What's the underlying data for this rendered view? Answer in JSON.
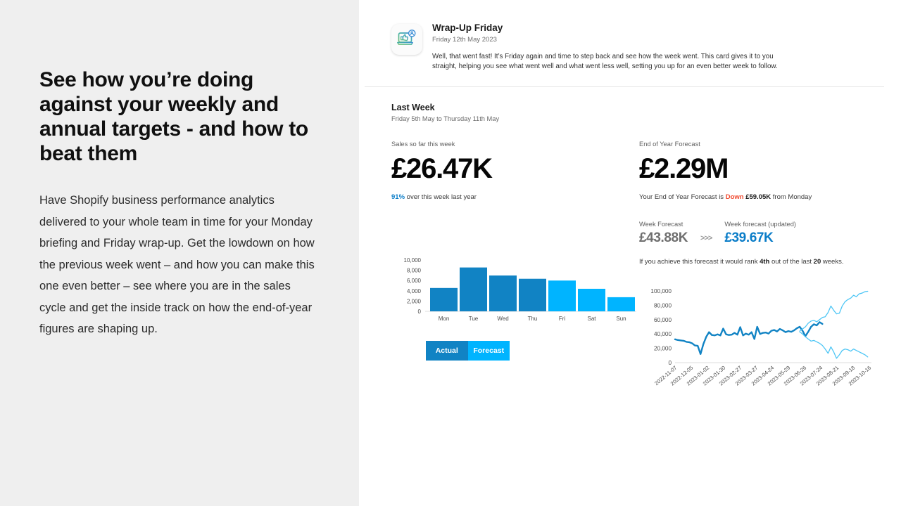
{
  "left": {
    "headline": "See how you’re doing against your weekly and annual targets - and how to beat them",
    "body": "Have Shopify business performance analytics delivered to your whole team in time for your Monday briefing and Friday wrap-up.  Get the lowdown on how the previous week went – and how you can make this one even better – see where you are in the sales cycle and get the inside track on how the end-of-year figures are shaping up."
  },
  "card": {
    "icon_name": "laptop-thumbs-up-icon",
    "title": "Wrap-Up Friday",
    "date": "Friday 12th May 2023",
    "body": "Well, that went fast! It’s Friday again and time to step back and see how the week went. This card gives it to you straight, helping you see what went well and what went less well, setting you up for an even better week to follow."
  },
  "section": {
    "title": "Last Week",
    "subtitle": "Friday 5th May to Thursday 11th May"
  },
  "sales": {
    "label": "Sales so far this week",
    "value": "£26.47K",
    "note_pct": "91%",
    "note_rest": " over this week last year"
  },
  "forecast": {
    "label": "End of Year Forecast",
    "value": "£2.29M",
    "note_prefix": "Your End of Year Forecast is ",
    "note_direction": "Down",
    "note_amount": " £59.05K",
    "note_suffix": " from Monday",
    "week_label_old": "Week Forecast",
    "week_value_old": "£43.88K",
    "arrow": ">>>",
    "week_label_new": "Week forecast (updated)",
    "week_value_new": "£39.67K",
    "rank_prefix": "If you achieve this forecast it would rank ",
    "rank_value": "4th",
    "rank_middle": " out of the last ",
    "rank_total": "20",
    "rank_suffix": " weeks."
  },
  "legend": {
    "actual": "Actual",
    "forecast": "Forecast"
  },
  "colors": {
    "actual_blue": "#1183c4",
    "forecast_blue": "#00b4ff",
    "accent_link": "#0b7dc8",
    "down_red": "#f0492f",
    "panel_gray": "#efefef"
  },
  "chart_data": [
    {
      "type": "bar",
      "title": "",
      "xlabel": "",
      "ylabel": "",
      "ylim": [
        0,
        10000
      ],
      "yticks": [
        "0",
        "2,000",
        "4,000",
        "6,000",
        "8,000",
        "10,000"
      ],
      "ytick_values": [
        0,
        2000,
        4000,
        6000,
        8000,
        10000
      ],
      "grid": false,
      "categories": [
        "Mon",
        "Tue",
        "Wed",
        "Thu",
        "Fri",
        "Sat",
        "Sun"
      ],
      "series": [
        {
          "name": "Actual",
          "color": "#1183c4",
          "values": [
            4550,
            8550,
            7000,
            6350,
            null,
            null,
            null
          ]
        },
        {
          "name": "Forecast",
          "color": "#00b4ff",
          "values": [
            null,
            null,
            null,
            null,
            6000,
            4400,
            2750
          ]
        }
      ],
      "legend_position": "bottom-left"
    },
    {
      "type": "line",
      "title": "",
      "xlabel": "",
      "ylabel": "",
      "ylim": [
        0,
        100000
      ],
      "yticks": [
        "0",
        "20,000",
        "40,000",
        "60,000",
        "80,000",
        "100,000"
      ],
      "ytick_values": [
        0,
        20000,
        40000,
        60000,
        80000,
        100000
      ],
      "grid": false,
      "xticks": [
        "2022-11-07",
        "2022-12-05",
        "2023-01-02",
        "2023-01-30",
        "2023-02-27",
        "2023-03-27",
        "2023-04-24",
        "2023-05-29",
        "2023-06-26",
        "2023-07-24",
        "2023-08-21",
        "2023-09-18",
        "2023-10-16"
      ],
      "series": [
        {
          "name": "Actual / Forecast (central)",
          "color": "#1183c4",
          "width": "thick",
          "x": [
            0,
            1,
            2,
            3,
            4,
            5,
            6,
            7,
            8,
            9,
            10,
            11,
            12,
            13,
            14,
            15,
            16,
            17,
            18,
            19,
            20,
            21,
            22,
            23,
            24,
            25,
            26,
            27,
            28,
            29,
            30,
            31,
            32,
            33,
            34,
            35,
            36,
            37,
            38,
            39,
            40,
            41,
            42,
            43,
            44,
            45,
            46,
            47,
            48,
            49,
            50,
            51,
            52
          ],
          "values": [
            32500,
            31500,
            31000,
            30500,
            29000,
            28500,
            27000,
            24000,
            23500,
            12000,
            26000,
            36000,
            42500,
            38500,
            38000,
            39500,
            38000,
            47500,
            38500,
            37500,
            38000,
            40500,
            38000,
            48500,
            37500,
            40000,
            38500,
            42000,
            32500,
            49500,
            40000,
            41500,
            42000,
            40500,
            44500,
            45500,
            43500,
            47000,
            45000,
            42500,
            44000,
            43000,
            45000,
            48000,
            50000,
            44500,
            37000,
            43000,
            50000,
            53500,
            52000,
            56500,
            54000
          ]
        },
        {
          "name": "Upper forecast band",
          "color": "#4ec6f5",
          "width": "thin",
          "x": [
            44,
            45,
            46,
            47,
            48,
            49,
            50,
            51,
            52,
            53,
            54,
            55,
            56,
            57,
            58,
            59,
            60,
            61,
            62,
            63,
            64,
            65,
            66,
            67,
            68
          ],
          "values": [
            44000,
            47000,
            50000,
            55000,
            58000,
            59000,
            57000,
            60000,
            63000,
            64000,
            70000,
            79000,
            73000,
            68000,
            69000,
            79000,
            85000,
            88000,
            90000,
            94000,
            92000,
            96000,
            97000,
            99000,
            99500
          ]
        },
        {
          "name": "Lower forecast band",
          "color": "#4ec6f5",
          "width": "thin",
          "x": [
            44,
            45,
            46,
            47,
            48,
            49,
            50,
            51,
            52,
            53,
            54,
            55,
            56,
            57,
            58,
            59,
            60,
            61,
            62,
            63,
            64,
            65,
            66,
            67,
            68
          ],
          "values": [
            43000,
            40000,
            36000,
            33000,
            30000,
            31000,
            29000,
            27000,
            24000,
            19000,
            13000,
            22000,
            15000,
            6000,
            11000,
            17000,
            19000,
            18000,
            16000,
            19000,
            17000,
            15000,
            13000,
            11000,
            8000
          ]
        }
      ],
      "legend_position": "none"
    }
  ]
}
